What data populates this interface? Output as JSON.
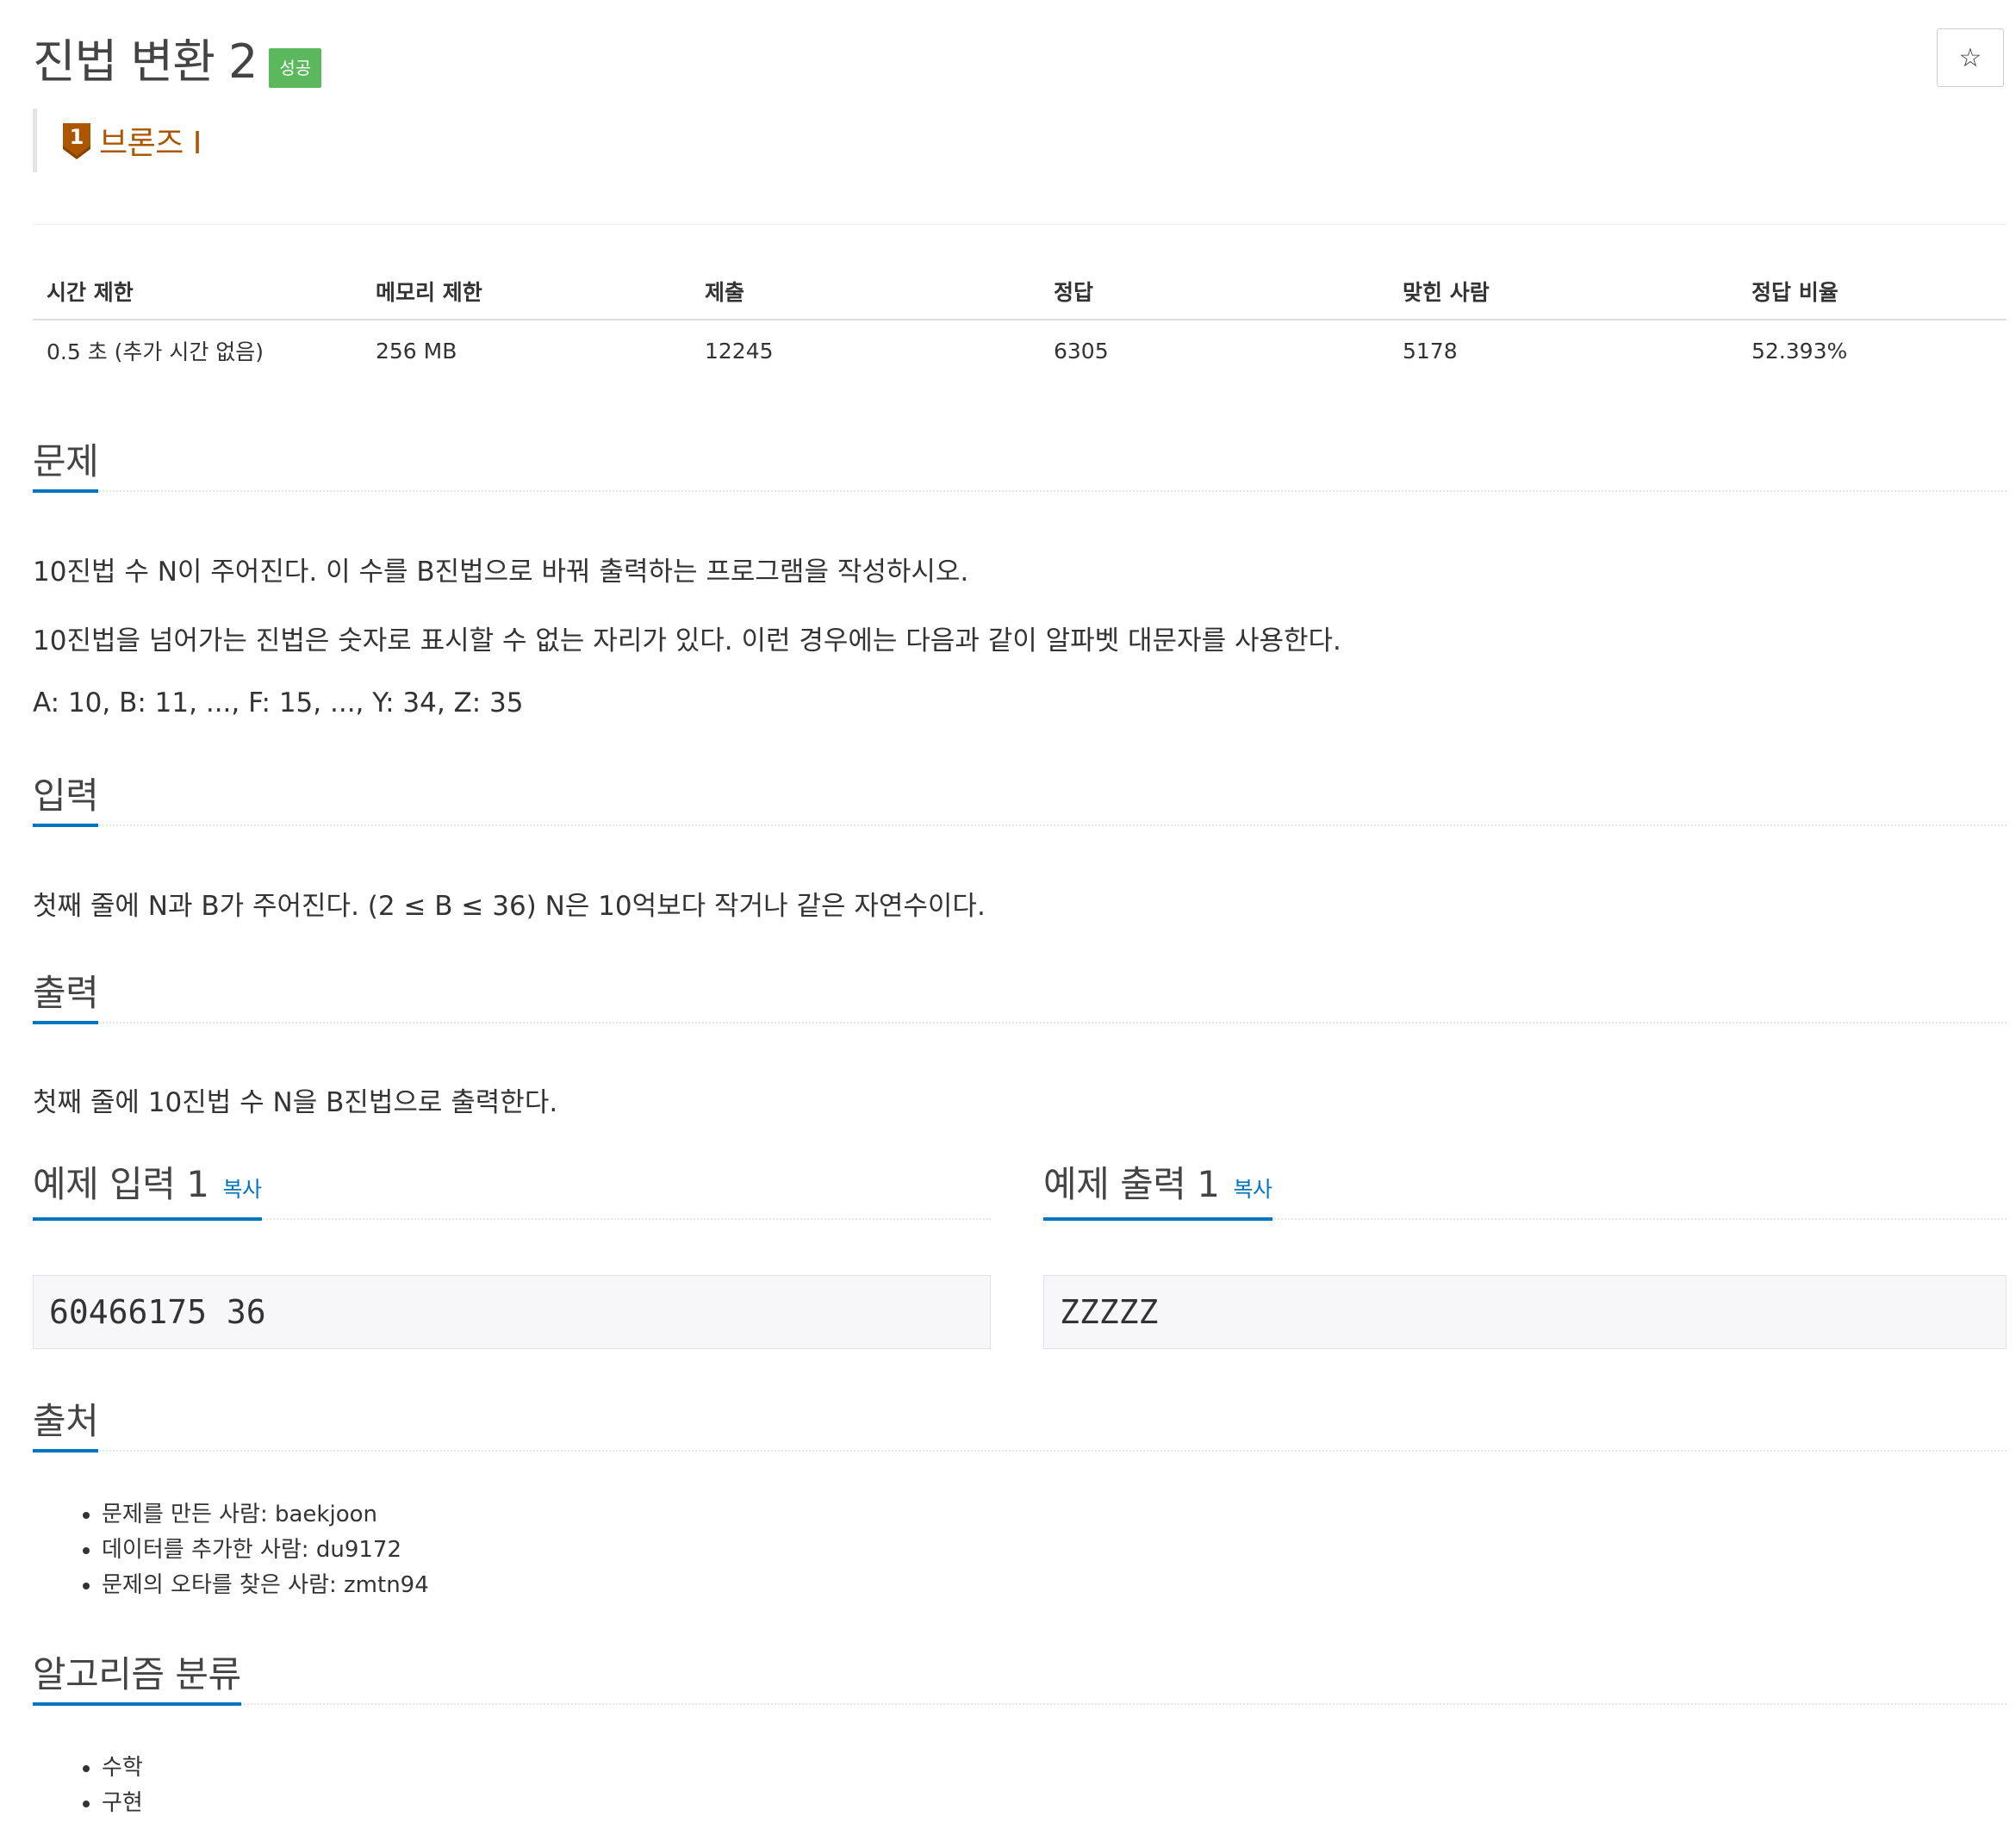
{
  "title": "진법 변환 2",
  "status_badge": "성공",
  "star_icon": "☆",
  "tier": {
    "label": "브론즈 I",
    "number": "1",
    "color": "#ad5600"
  },
  "stats": {
    "headers": [
      "시간 제한",
      "메모리 제한",
      "제출",
      "정답",
      "맞힌 사람",
      "정답 비율"
    ],
    "values": [
      "0.5 초 (추가 시간 없음)",
      "256 MB",
      "12245",
      "6305",
      "5178",
      "52.393%"
    ]
  },
  "problem": {
    "heading": "문제",
    "paragraphs": [
      "10진법 수 N이 주어진다. 이 수를 B진법으로 바꿔 출력하는 프로그램을 작성하시오.",
      "10진법을 넘어가는 진법은 숫자로 표시할 수 없는 자리가 있다. 이런 경우에는 다음과 같이 알파벳 대문자를 사용한다.",
      "A: 10, B: 11, ..., F: 15, ..., Y: 34, Z: 35"
    ]
  },
  "input": {
    "heading": "입력",
    "text": "첫째 줄에 N과 B가 주어진다. (2 ≤ B ≤ 36) N은 10억보다 작거나 같은 자연수이다."
  },
  "output": {
    "heading": "출력",
    "text": "첫째 줄에 10진법 수 N을 B진법으로 출력한다."
  },
  "samples": {
    "input_heading": "예제 입력 1",
    "output_heading": "예제 출력 1",
    "copy_label": "복사",
    "input_value": "60466175 36",
    "output_value": "ZZZZZ"
  },
  "source": {
    "heading": "출처",
    "items": [
      "문제를 만든 사람: baekjoon",
      "데이터를 추가한 사람: du9172",
      "문제의 오타를 찾은 사람: zmtn94"
    ]
  },
  "algorithms": {
    "heading": "알고리즘 분류",
    "items": [
      "수학",
      "구현"
    ]
  },
  "colors": {
    "accent": "#0076c0",
    "success": "#5cb85c",
    "bronze": "#ad5600"
  }
}
